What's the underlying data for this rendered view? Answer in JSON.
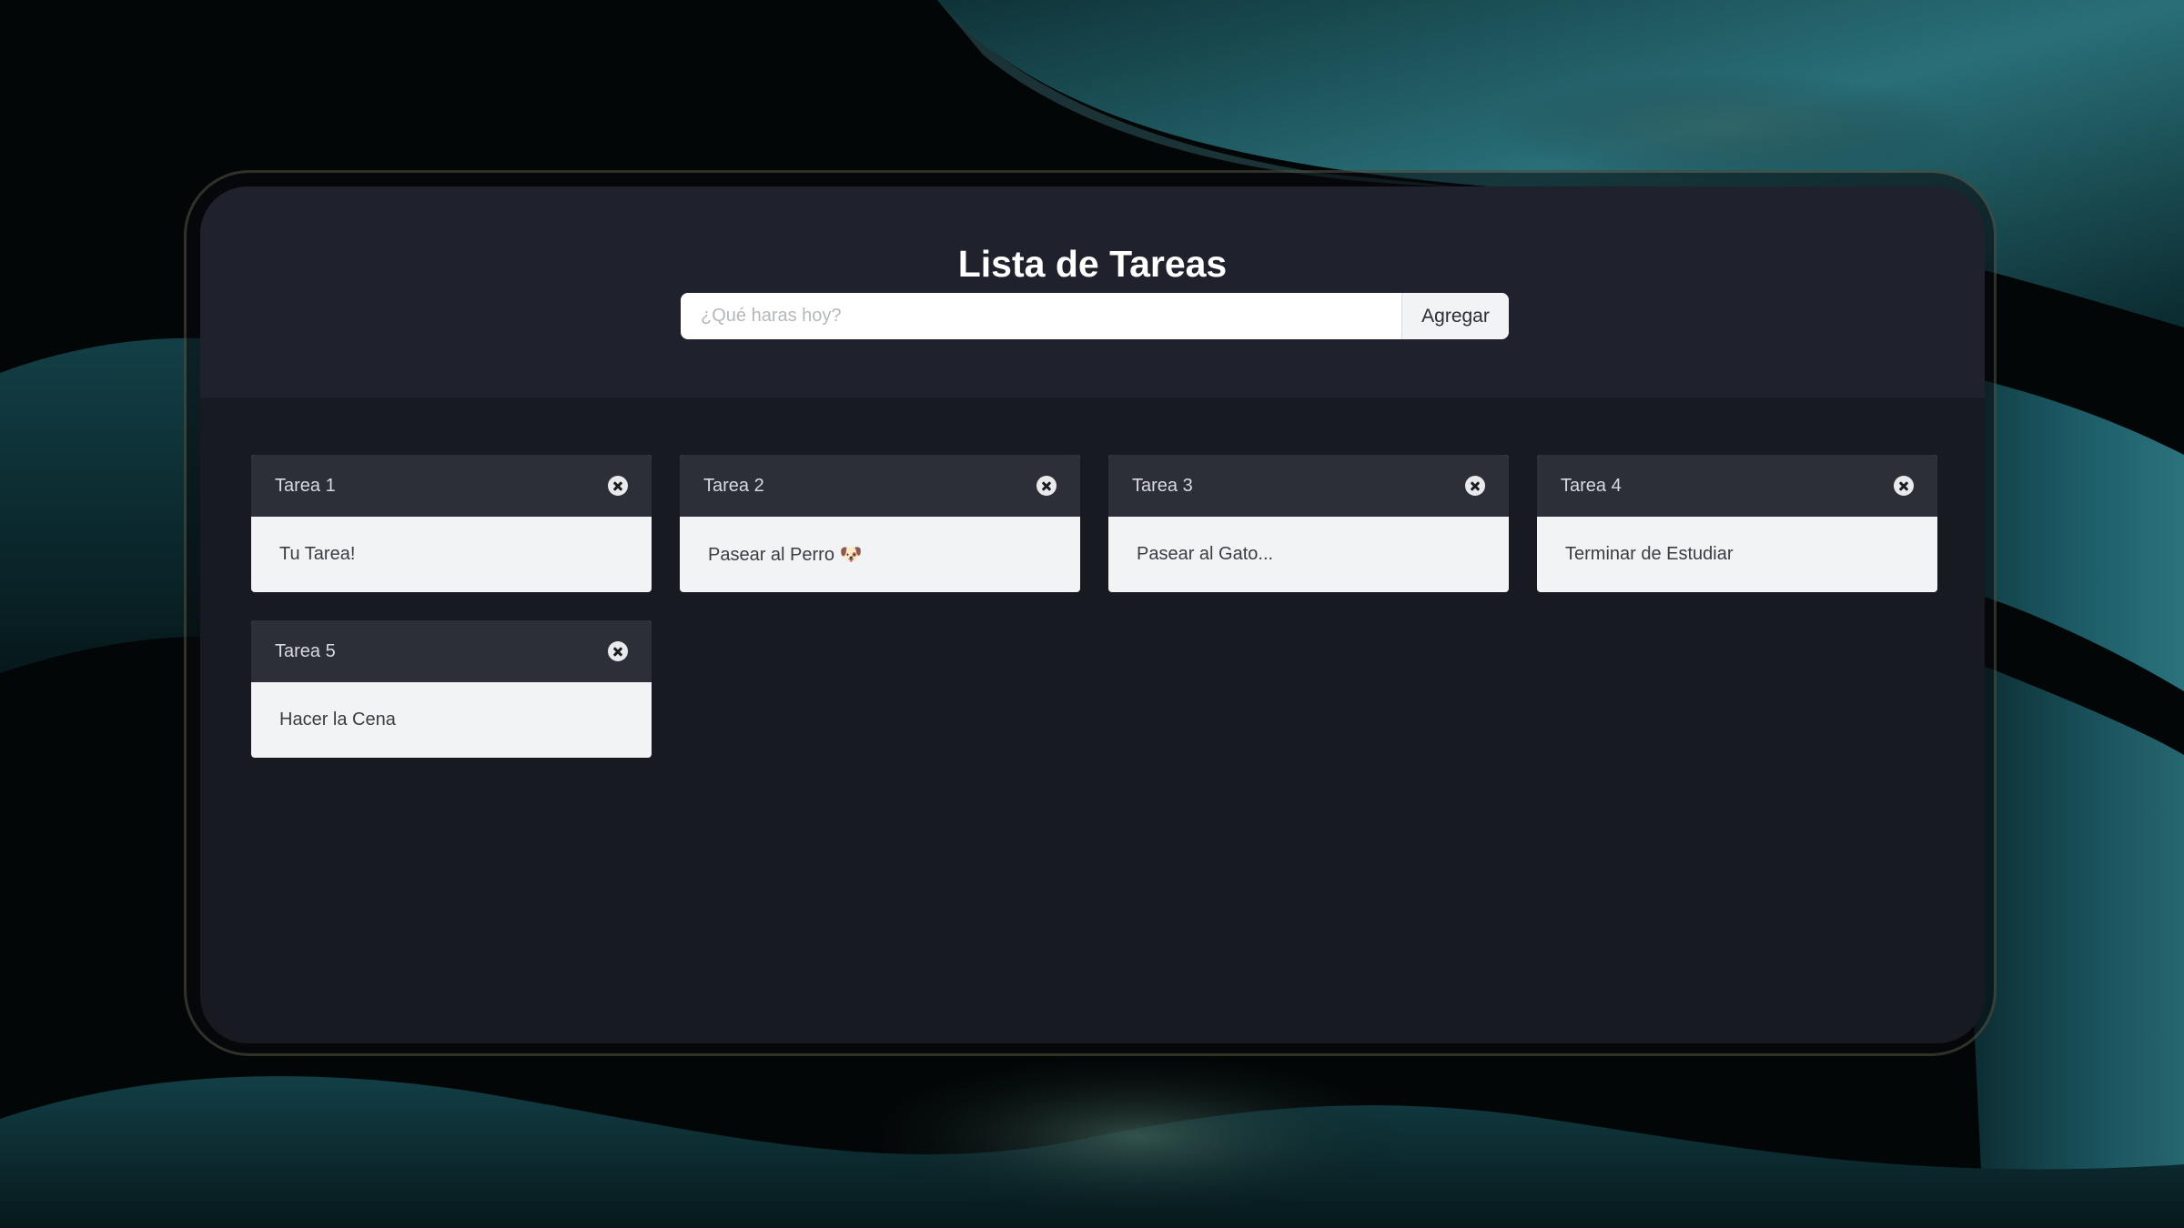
{
  "colors": {
    "app_bg": "#171a20",
    "header_bg": "#1f222c",
    "card_header_bg": "#2c2f37",
    "card_body_bg": "#f2f3f5",
    "wallpaper_teal": "#1f6a73"
  },
  "header": {
    "title": "Lista de Tareas",
    "input": {
      "placeholder": "¿Qué haras hoy?",
      "value": ""
    },
    "add_label": "Agregar"
  },
  "tasks": [
    {
      "title": "Tarea 1",
      "text": "Tu Tarea!",
      "close_icon": "close-icon"
    },
    {
      "title": "Tarea 2",
      "text": "Pasear al Perro 🐶",
      "close_icon": "close-icon"
    },
    {
      "title": "Tarea 3",
      "text": "Pasear al Gato...",
      "close_icon": "close-icon"
    },
    {
      "title": "Tarea 4",
      "text": "Terminar de Estudiar",
      "close_icon": "close-icon"
    },
    {
      "title": "Tarea 5",
      "text": "Hacer la Cena",
      "close_icon": "close-icon"
    }
  ]
}
